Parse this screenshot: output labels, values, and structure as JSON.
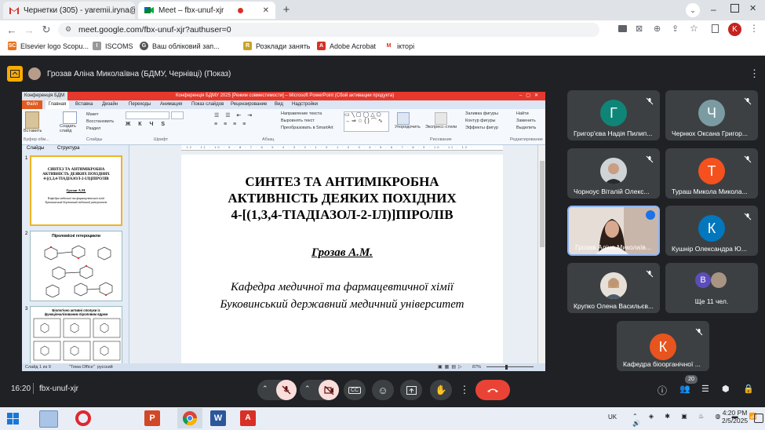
{
  "browser": {
    "tabs": [
      {
        "title": "Чернетки (305) - yaremii.iryna@",
        "icon": "gmail-icon"
      },
      {
        "title": "Meet – fbx-unuf-xjr",
        "icon": "meet-icon",
        "active": true
      }
    ],
    "url": "meet.google.com/fbx-unuf-xjr?authuser=0",
    "profile_initial": "K",
    "bookmarks": [
      {
        "label": "Elsevier logo Scopu...",
        "icon": "SC",
        "color": "#e9711c"
      },
      {
        "label": "ISCOMS",
        "icon": "I",
        "color": "#777"
      },
      {
        "label": "Ваш обліковий зап...",
        "icon": "G",
        "color": "#555"
      },
      {
        "label": "Розклади занять",
        "icon": "R",
        "color": "#c9a227"
      },
      {
        "label": "Adobe Acrobat",
        "icon": "A",
        "color": "#d93025"
      },
      {
        "label": "ікторі",
        "icon": "M",
        "color": "#d93025"
      }
    ]
  },
  "meet": {
    "presenter_label": "Грозав Аліна Миколаївна (БДМУ, Чернівці) (Показ)",
    "time": "16:20",
    "meeting_code": "fbx-unuf-xjr",
    "participants_count": "20",
    "participants": [
      {
        "name": "Григор'єва Надія Пилип...",
        "initial": "Г",
        "color": "#0f8578",
        "muted": true
      },
      {
        "name": "Чернюх Оксана Григор...",
        "initial": "Ч",
        "color": "#7b9ba2",
        "muted": true
      },
      {
        "name": "Чорноус Віталій Олекс...",
        "initial": "",
        "color": "#777",
        "photo": true,
        "muted": true
      },
      {
        "name": "Тураш Микола Микола...",
        "initial": "Т",
        "color": "#f4511e",
        "muted": true
      },
      {
        "name": "Грозав Аліна Миколаїв...",
        "initial": "",
        "color": "#cfc4bc",
        "photo": true,
        "speaking": true
      },
      {
        "name": "Кушнір Олександра Ю...",
        "initial": "К",
        "color": "#0277bd",
        "muted": true
      },
      {
        "name": "Крупко Олена Васильєв...",
        "initial": "",
        "color": "#888",
        "photo": true,
        "muted": true
      },
      {
        "name": "Ще 11 чел.",
        "initial": "В",
        "color": "#5b4dbb",
        "more": true
      },
      {
        "name": "Кафедра біоорганічної ...",
        "initial": "К",
        "color": "#e8541e",
        "muted": true
      }
    ]
  },
  "ppt": {
    "title": "Конференція БДМУ 2025 [Режим совместимости] – Microsoft PowerPoint (Сбой активации продукта)",
    "quick_tab": "Конференція БДМ",
    "ribbon_tabs": [
      "Файл",
      "Главная",
      "Вставка",
      "Дизайн",
      "Переходы",
      "Анимация",
      "Показ слайдов",
      "Рецензирование",
      "Вид",
      "Надстройки"
    ],
    "groups": [
      "Буфер обм...",
      "Слайды",
      "Шрифт",
      "Абзац",
      "Рисование",
      "Редактирование"
    ],
    "buttons": {
      "paste": "Вставить",
      "new_slide": "Создать слайд",
      "layout": "Макет",
      "restore": "Восстановить",
      "section": "Раздел",
      "arrange": "Упорядочить",
      "quick_styles": "Экспресс-стили",
      "find": "Найти",
      "replace": "Заменить",
      "select": "Выделить",
      "text_direction": "Направление текста",
      "align_text": "Выровнять текст",
      "convert_smartart": "Преобразовать в SmartArt",
      "shape_fill": "Заливка фигуры",
      "shape_outline": "Контур фигуры",
      "shape_effects": "Эффекты фигур"
    },
    "pane_tabs": [
      "Слайды",
      "Структура"
    ],
    "thumbs": [
      {
        "num": "1",
        "lines": [
          "СИНТЕЗ ТА АНТИМІКРОБНА",
          "АКТИВНІСТЬ ДЕЯКИХ ПОХІДНИХ",
          "4-[(1,3,4-ТІАДІАЗОЛ-2-ІЛ)]ПІРОЛІВ"
        ],
        "author": "Грозав А.М.",
        "sub": [
          "Кафедра медичної та фармацевтичної хімії",
          "Буковинський державний медичний університет"
        ]
      },
      {
        "num": "2",
        "title": "Піроломісні гетероцикли"
      },
      {
        "num": "3",
        "title": "Біологічно активні сполуки із функціоналізованим піроловим ядром"
      }
    ],
    "slide": {
      "title_lines": [
        "СИНТЕЗ ТА АНТИМІКРОБНА",
        "АКТИВНІСТЬ ДЕЯКИХ ПОХІДНИХ",
        "4-[(1,3,4-ТІАДІАЗОЛ-2-ІЛ)]ПІРОЛІВ"
      ],
      "author": "Грозав А.М.",
      "dept": "Кафедра медичної та фармацевтичної хімії",
      "univ": "Буковинський державний медичний університет"
    },
    "status": {
      "slide": "Слайд 1 из 9",
      "theme": "\"Тема Office\"",
      "lang": "русский",
      "zoom": "87%"
    }
  },
  "taskbar": {
    "lang": "UK",
    "time": "4:20 PM",
    "date": "2/5/2025"
  }
}
